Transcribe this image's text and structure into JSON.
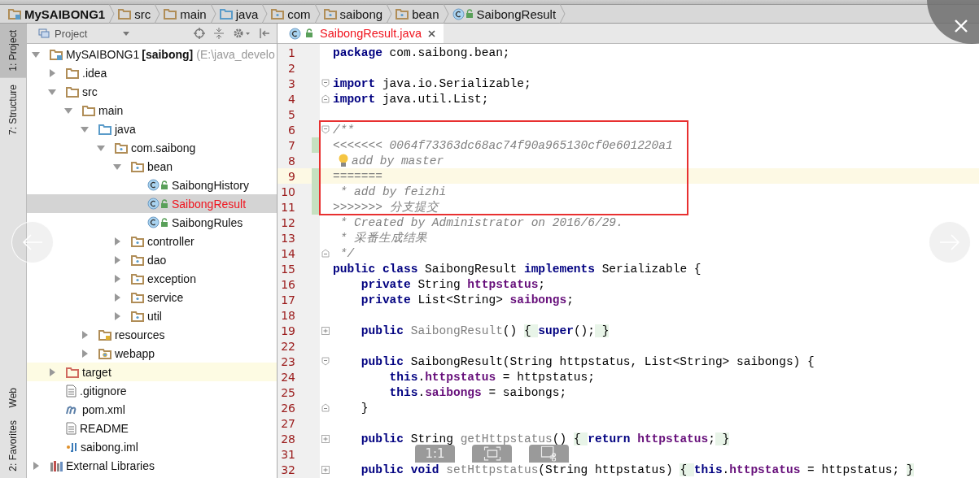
{
  "breadcrumbs": [
    {
      "kind": "module",
      "label": "MySAIBONG1"
    },
    {
      "kind": "folder",
      "label": "src"
    },
    {
      "kind": "folder",
      "label": "main"
    },
    {
      "kind": "source",
      "label": "java"
    },
    {
      "kind": "package",
      "label": "com"
    },
    {
      "kind": "package",
      "label": "saibong"
    },
    {
      "kind": "package",
      "label": "bean"
    },
    {
      "kind": "class",
      "label": "SaibongResult"
    }
  ],
  "tool_strip": {
    "top": [
      {
        "label": "1: Project",
        "selected": true
      },
      {
        "label": "7: Structure",
        "selected": false
      }
    ],
    "bottom": [
      {
        "label": "Web",
        "selected": false
      },
      {
        "label": "2: Favorites",
        "selected": false
      }
    ]
  },
  "project_panel": {
    "title": "Project",
    "tree": [
      {
        "kind": "module",
        "name": "MySAIBONG1",
        "module": "[saibong]",
        "path": "(E:\\java_develo",
        "expanded": true,
        "selected": false,
        "highlighted": false,
        "conflicted": false,
        "children": [
          {
            "kind": "folder",
            "name": ".idea",
            "expanded": false,
            "selected": false,
            "highlighted": false,
            "conflicted": false
          },
          {
            "kind": "folder",
            "name": "src",
            "expanded": true,
            "selected": false,
            "highlighted": false,
            "conflicted": false,
            "children": [
              {
                "kind": "folder",
                "name": "main",
                "expanded": true,
                "selected": false,
                "highlighted": false,
                "conflicted": false,
                "children": [
                  {
                    "kind": "source",
                    "name": "java",
                    "expanded": true,
                    "selected": false,
                    "highlighted": false,
                    "conflicted": false,
                    "children": [
                      {
                        "kind": "package",
                        "name": "com.saibong",
                        "expanded": true,
                        "selected": false,
                        "highlighted": false,
                        "conflicted": false,
                        "children": [
                          {
                            "kind": "package",
                            "name": "bean",
                            "expanded": true,
                            "selected": false,
                            "highlighted": false,
                            "conflicted": false,
                            "children": [
                              {
                                "kind": "class",
                                "name": "SaibongHistory",
                                "selected": false,
                                "highlighted": false,
                                "conflicted": false
                              },
                              {
                                "kind": "class",
                                "name": "SaibongResult",
                                "selected": true,
                                "highlighted": false,
                                "conflicted": true
                              },
                              {
                                "kind": "class",
                                "name": "SaibongRules",
                                "selected": false,
                                "highlighted": false,
                                "conflicted": false
                              }
                            ]
                          },
                          {
                            "kind": "package",
                            "name": "controller",
                            "expanded": false,
                            "selected": false,
                            "highlighted": false,
                            "conflicted": false
                          },
                          {
                            "kind": "package",
                            "name": "dao",
                            "expanded": false,
                            "selected": false,
                            "highlighted": false,
                            "conflicted": false
                          },
                          {
                            "kind": "package",
                            "name": "exception",
                            "expanded": false,
                            "selected": false,
                            "highlighted": false,
                            "conflicted": false
                          },
                          {
                            "kind": "package",
                            "name": "service",
                            "expanded": false,
                            "selected": false,
                            "highlighted": false,
                            "conflicted": false
                          },
                          {
                            "kind": "package",
                            "name": "util",
                            "expanded": false,
                            "selected": false,
                            "highlighted": false,
                            "conflicted": false
                          }
                        ]
                      }
                    ]
                  },
                  {
                    "kind": "resources",
                    "name": "resources",
                    "expanded": false,
                    "selected": false,
                    "highlighted": false,
                    "conflicted": false
                  },
                  {
                    "kind": "web",
                    "name": "webapp",
                    "expanded": false,
                    "selected": false,
                    "highlighted": false,
                    "conflicted": false
                  }
                ]
              }
            ]
          },
          {
            "kind": "excluded",
            "name": "target",
            "expanded": false,
            "selected": false,
            "highlighted": true,
            "conflicted": false
          },
          {
            "kind": "text",
            "name": ".gitignore",
            "selected": false,
            "highlighted": false,
            "conflicted": false
          },
          {
            "kind": "maven",
            "name": "pom.xml",
            "selected": false,
            "highlighted": false,
            "conflicted": false
          },
          {
            "kind": "text",
            "name": "README",
            "selected": false,
            "highlighted": false,
            "conflicted": false
          },
          {
            "kind": "iml",
            "name": "saibong.iml",
            "selected": false,
            "highlighted": false,
            "conflicted": false
          }
        ]
      },
      {
        "kind": "libraries",
        "name": "External Libraries",
        "expanded": false,
        "selected": false,
        "highlighted": false,
        "conflicted": false
      }
    ]
  },
  "editor": {
    "tabs": [
      {
        "label": "SaibongResult.java",
        "selected": true,
        "conflicted": true
      }
    ],
    "lines": [
      {
        "number": "1",
        "caret": false,
        "changed": false,
        "kind": "plain",
        "tokens": [
          {
            "kind": "kw",
            "text": "package"
          },
          {
            "kind": "plain",
            "text": " com.saibong.bean;"
          }
        ]
      },
      {
        "number": "2",
        "caret": false,
        "changed": false,
        "kind": "plain"
      },
      {
        "number": "3",
        "caret": false,
        "changed": false,
        "kind": "fold-start",
        "tokens": [
          {
            "kind": "kw",
            "text": "import"
          },
          {
            "kind": "plain",
            "text": " java.io.Serializable;"
          }
        ]
      },
      {
        "number": "4",
        "caret": false,
        "changed": false,
        "kind": "fold-end",
        "tokens": [
          {
            "kind": "kw",
            "text": "import"
          },
          {
            "kind": "plain",
            "text": " java.util.List;"
          }
        ]
      },
      {
        "number": "5",
        "caret": false,
        "changed": false,
        "kind": "plain"
      },
      {
        "number": "6",
        "caret": false,
        "changed": false,
        "kind": "fold-start",
        "tokens": [
          {
            "kind": "comment",
            "text": "/**"
          }
        ]
      },
      {
        "number": "7",
        "caret": false,
        "changed": true,
        "kind": "plain",
        "tokens": [
          {
            "kind": "comment",
            "text": "<<<<<<< 0064f73363dc68ac74f90a965130cf0e601220a1"
          }
        ]
      },
      {
        "number": "8",
        "caret": false,
        "changed": false,
        "kind": "plain",
        "tokens": [
          {
            "kind": "bulb"
          },
          {
            "kind": "comment",
            "text": "add by master"
          }
        ]
      },
      {
        "number": "9",
        "caret": true,
        "changed": true,
        "kind": "plain",
        "tokens": [
          {
            "kind": "comment",
            "text": "======="
          }
        ]
      },
      {
        "number": "10",
        "caret": false,
        "changed": true,
        "kind": "plain",
        "tokens": [
          {
            "kind": "comment",
            "text": " * add by feizhi"
          }
        ]
      },
      {
        "number": "11",
        "caret": false,
        "changed": true,
        "kind": "plain",
        "tokens": [
          {
            "kind": "comment",
            "text": ">>>>>>> 分支提交"
          }
        ]
      },
      {
        "number": "12",
        "caret": false,
        "changed": false,
        "kind": "plain",
        "tokens": [
          {
            "kind": "comment",
            "text": " * Created by Administrator on 2016/6/29."
          }
        ]
      },
      {
        "number": "13",
        "caret": false,
        "changed": false,
        "kind": "plain",
        "tokens": [
          {
            "kind": "comment",
            "text": " * 采番生成结果"
          }
        ]
      },
      {
        "number": "14",
        "caret": false,
        "changed": false,
        "kind": "fold-end",
        "tokens": [
          {
            "kind": "comment",
            "text": " */"
          }
        ]
      },
      {
        "number": "15",
        "caret": false,
        "changed": false,
        "kind": "plain",
        "tokens": [
          {
            "kind": "kw",
            "text": "public class"
          },
          {
            "kind": "plain",
            "text": " SaibongResult "
          },
          {
            "kind": "kw",
            "text": "implements"
          },
          {
            "kind": "plain",
            "text": " Serializable {"
          }
        ]
      },
      {
        "number": "16",
        "caret": false,
        "changed": false,
        "kind": "plain",
        "tokens": [
          {
            "kind": "kw",
            "text": "    private"
          },
          {
            "kind": "plain",
            "text": " String "
          },
          {
            "kind": "field",
            "text": "httpstatus"
          },
          {
            "kind": "plain",
            "text": ";"
          }
        ]
      },
      {
        "number": "17",
        "caret": false,
        "changed": false,
        "kind": "plain",
        "tokens": [
          {
            "kind": "kw",
            "text": "    private"
          },
          {
            "kind": "plain",
            "text": " List<String> "
          },
          {
            "kind": "field",
            "text": "saibongs"
          },
          {
            "kind": "plain",
            "text": ";"
          }
        ]
      },
      {
        "number": "18",
        "caret": false,
        "changed": false,
        "kind": "plain"
      },
      {
        "number": "19",
        "caret": false,
        "changed": false,
        "kind": "folded",
        "tokens": [
          {
            "kind": "kw",
            "text": "    public "
          },
          {
            "kind": "unused",
            "text": "SaibongResult"
          },
          {
            "kind": "plain",
            "text": "() "
          },
          {
            "kind": "folded",
            "text": "{ "
          },
          {
            "kind": "kw",
            "text": "super"
          },
          {
            "kind": "plain",
            "text": "();"
          },
          {
            "kind": "folded",
            "text": " }"
          }
        ]
      },
      {
        "number": "22",
        "caret": false,
        "changed": false,
        "kind": "plain"
      },
      {
        "number": "23",
        "caret": false,
        "changed": false,
        "kind": "fold-start",
        "tokens": [
          {
            "kind": "kw",
            "text": "    public"
          },
          {
            "kind": "plain",
            "text": " SaibongResult(String httpstatus, List<String> saibongs) {"
          }
        ]
      },
      {
        "number": "24",
        "caret": false,
        "changed": false,
        "kind": "plain",
        "tokens": [
          {
            "kind": "kw",
            "text": "        this"
          },
          {
            "kind": "plain",
            "text": "."
          },
          {
            "kind": "field",
            "text": "httpstatus"
          },
          {
            "kind": "plain",
            "text": " = httpstatus;"
          }
        ]
      },
      {
        "number": "25",
        "caret": false,
        "changed": false,
        "kind": "plain",
        "tokens": [
          {
            "kind": "kw",
            "text": "        this"
          },
          {
            "kind": "plain",
            "text": "."
          },
          {
            "kind": "field",
            "text": "saibongs"
          },
          {
            "kind": "plain",
            "text": " = saibongs;"
          }
        ]
      },
      {
        "number": "26",
        "caret": false,
        "changed": false,
        "kind": "fold-end",
        "tokens": [
          {
            "kind": "plain",
            "text": "    }"
          }
        ]
      },
      {
        "number": "27",
        "caret": false,
        "changed": false,
        "kind": "plain"
      },
      {
        "number": "28",
        "caret": false,
        "changed": false,
        "kind": "folded",
        "tokens": [
          {
            "kind": "kw",
            "text": "    public"
          },
          {
            "kind": "plain",
            "text": " String "
          },
          {
            "kind": "unused",
            "text": "getHttpstatus"
          },
          {
            "kind": "plain",
            "text": "() "
          },
          {
            "kind": "folded",
            "text": "{ "
          },
          {
            "kind": "kw",
            "text": "return "
          },
          {
            "kind": "field",
            "text": "httpstatus"
          },
          {
            "kind": "plain",
            "text": ";"
          },
          {
            "kind": "folded",
            "text": " }"
          }
        ]
      },
      {
        "number": "31",
        "caret": false,
        "changed": false,
        "kind": "plain"
      },
      {
        "number": "32",
        "caret": false,
        "changed": false,
        "kind": "folded",
        "tokens": [
          {
            "kind": "kw",
            "text": "    public void "
          },
          {
            "kind": "unused",
            "text": "setHttpstatus"
          },
          {
            "kind": "plain",
            "text": "(String httpstatus) "
          },
          {
            "kind": "folded",
            "text": "{ "
          },
          {
            "kind": "kw",
            "text": "this"
          },
          {
            "kind": "plain",
            "text": "."
          },
          {
            "kind": "field",
            "text": "httpstatus"
          },
          {
            "kind": "plain",
            "text": " = httpstatus; "
          },
          {
            "kind": "folded",
            "text": "}"
          }
        ]
      }
    ]
  },
  "viewer": {
    "buttons": [
      {
        "kind": "actual-size",
        "label": "1:1"
      },
      {
        "kind": "fit"
      },
      {
        "kind": "edit"
      }
    ]
  }
}
